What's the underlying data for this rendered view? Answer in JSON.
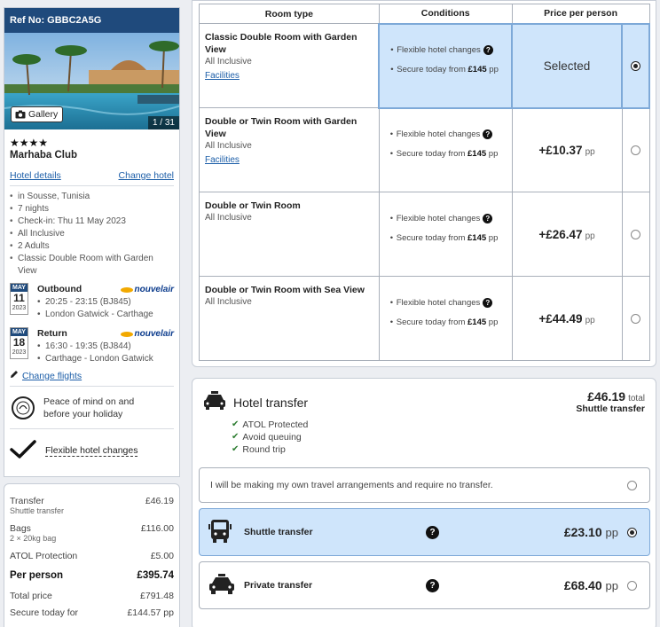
{
  "sidebar": {
    "ref": "Ref No: GBBC2A5G",
    "gallery_label": "Gallery",
    "photo_count": "1 / 31",
    "stars": "★★★★",
    "hotel_name": "Marhaba Club",
    "hotel_details_link": "Hotel details",
    "change_hotel_link": "Change hotel",
    "info": [
      "in Sousse, Tunisia",
      "7 nights",
      "Check-in: Thu 11 May 2023",
      "All Inclusive",
      "2 Adults",
      "Classic Double Room with Garden View"
    ],
    "outbound": {
      "month": "MAY",
      "day": "11",
      "year": "2023",
      "title": "Outbound",
      "time": "20:25 - 23:15 (BJ845)",
      "route": "London Gatwick - Carthage",
      "airline": "nouvelair"
    },
    "return": {
      "month": "MAY",
      "day": "18",
      "year": "2023",
      "title": "Return",
      "time": "16:30 - 19:35 (BJ844)",
      "route": "Carthage - London Gatwick",
      "airline": "nouvelair"
    },
    "change_flights": "Change flights",
    "peace_text": "Peace of mind on and before your holiday",
    "flex_changes": "Flexible hotel changes"
  },
  "price_summary": {
    "transfer_label": "Transfer",
    "transfer_sub": "Shuttle transfer",
    "transfer_value": "£46.19",
    "bags_label": "Bags",
    "bags_sub": "2 × 20kg bag",
    "bags_value": "£116.00",
    "atol_label": "ATOL Protection",
    "atol_value": "£5.00",
    "per_person_label": "Per person",
    "per_person_value": "£395.74",
    "total_label": "Total price",
    "total_value": "£791.48",
    "secure_label": "Secure today for",
    "secure_value": "£144.57 pp"
  },
  "rooms": {
    "headers": {
      "type": "Room type",
      "conditions": "Conditions",
      "price": "Price per person"
    },
    "cond1": "Flexible hotel changes",
    "cond2_prefix": "Secure today from ",
    "cond2_amount": "£145",
    "cond2_suffix": " pp",
    "pp": "pp",
    "list": [
      {
        "title": "Classic Double Room with Garden View",
        "board": "All Inclusive",
        "facilities": "Facilities",
        "price": "Selected"
      },
      {
        "title": "Double or Twin Room with Garden View",
        "board": "All Inclusive",
        "facilities": "Facilities",
        "price": "+£10.37"
      },
      {
        "title": "Double or Twin Room",
        "board": "All Inclusive",
        "price": "+£26.47"
      },
      {
        "title": "Double or Twin Room with Sea View",
        "board": "All Inclusive",
        "price": "+£44.49"
      }
    ]
  },
  "transfer": {
    "title": "Hotel transfer",
    "total_amount": "£46.19",
    "total_label": "total",
    "total_sub": "Shuttle transfer",
    "features": [
      "ATOL Protected",
      "Avoid queuing",
      "Round trip"
    ],
    "own_arrangements": "I will be making my own travel arrangements and require no transfer.",
    "shuttle_label": "Shuttle transfer",
    "shuttle_price": "£23.10",
    "private_label": "Private transfer",
    "private_price": "£68.40",
    "pp": "pp"
  },
  "colors": {
    "brand": "#1f4a7c",
    "selected_bg": "#cfe5fb",
    "link": "#1c5ea8",
    "tick": "#2e7d32"
  }
}
